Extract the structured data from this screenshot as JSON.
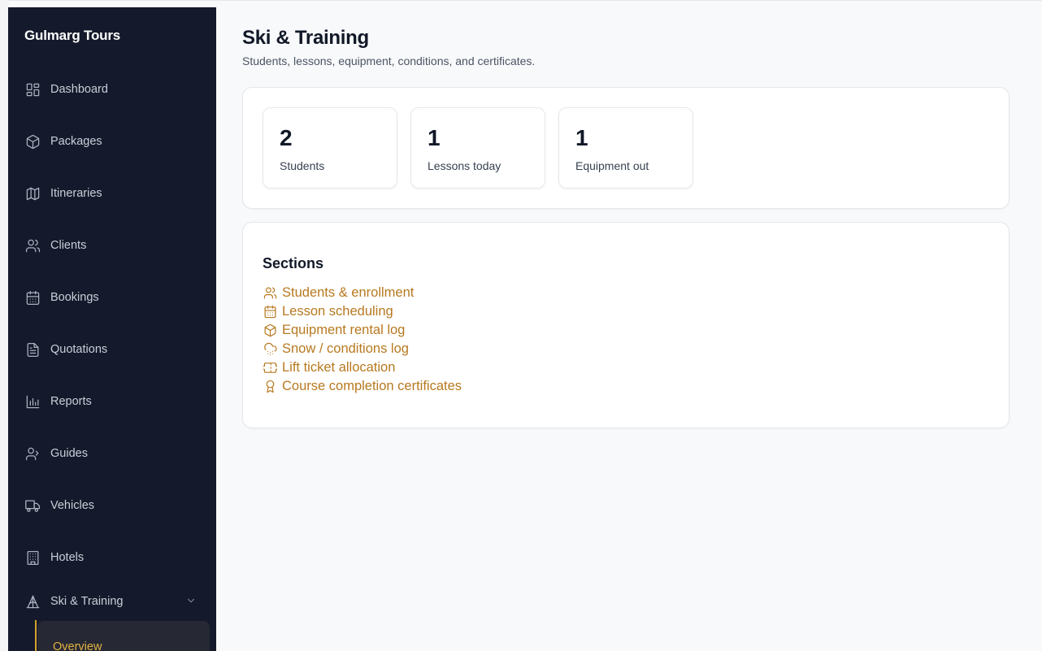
{
  "app": {
    "brand": "Gulmarg Tours"
  },
  "colors": {
    "sidebar_bg": "#141a2b",
    "accent": "#b7791f",
    "active_sub": "#e3b341",
    "page_bg": "#f8f9fb"
  },
  "sidebar": {
    "items": [
      {
        "label": "Dashboard",
        "icon": "dashboard-icon"
      },
      {
        "label": "Packages",
        "icon": "package-icon"
      },
      {
        "label": "Itineraries",
        "icon": "map-icon"
      },
      {
        "label": "Clients",
        "icon": "users-icon"
      },
      {
        "label": "Bookings",
        "icon": "calendar-icon"
      },
      {
        "label": "Quotations",
        "icon": "document-icon"
      },
      {
        "label": "Reports",
        "icon": "bar-chart-icon"
      },
      {
        "label": "Guides",
        "icon": "guide-icon"
      },
      {
        "label": "Vehicles",
        "icon": "truck-icon"
      },
      {
        "label": "Hotels",
        "icon": "building-icon"
      },
      {
        "label": "Ski & Training",
        "icon": "mountain-icon",
        "expanded": true
      }
    ],
    "sub_items": [
      {
        "label": "Overview",
        "active": true
      }
    ]
  },
  "header": {
    "title": "Ski & Training",
    "subtitle": "Students, lessons, equipment, conditions, and certificates."
  },
  "stats": [
    {
      "value": "2",
      "label": "Students"
    },
    {
      "value": "1",
      "label": "Lessons today"
    },
    {
      "value": "1",
      "label": "Equipment out"
    }
  ],
  "sections": {
    "title": "Sections",
    "links": [
      {
        "label": "Students & enrollment",
        "icon": "users-icon"
      },
      {
        "label": "Lesson scheduling",
        "icon": "calendar-icon"
      },
      {
        "label": "Equipment rental log",
        "icon": "package-icon"
      },
      {
        "label": "Snow / conditions log",
        "icon": "cloud-snow-icon"
      },
      {
        "label": "Lift ticket allocation",
        "icon": "ticket-icon"
      },
      {
        "label": "Course completion certificates",
        "icon": "award-icon"
      }
    ]
  }
}
